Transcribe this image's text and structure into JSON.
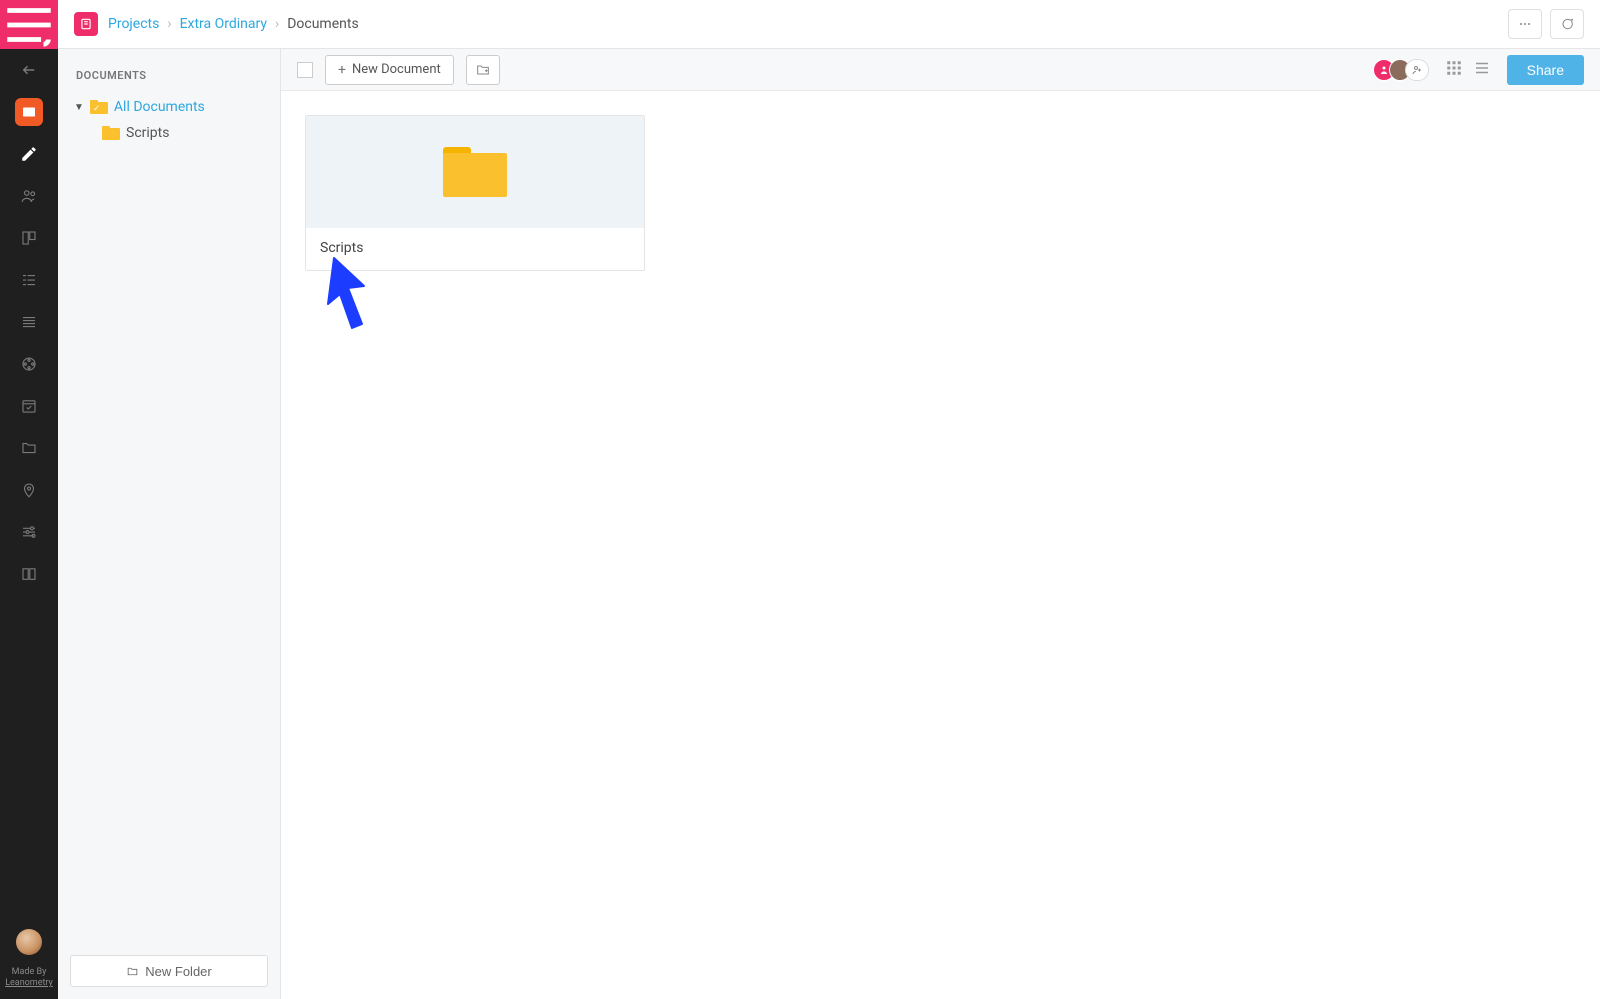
{
  "rail": {
    "credit_line1": "Made By",
    "credit_line2": "Leanometry"
  },
  "breadcrumb": {
    "root": "Projects",
    "project": "Extra Ordinary",
    "current": "Documents"
  },
  "sidebar": {
    "header": "DOCUMENTS",
    "all_docs": "All Documents",
    "tree": [
      {
        "label": "Scripts"
      }
    ],
    "new_folder_label": "New Folder"
  },
  "toolbar": {
    "new_doc_label": "New Document",
    "share_label": "Share"
  },
  "content": {
    "tiles": [
      {
        "name": "Scripts"
      }
    ]
  }
}
